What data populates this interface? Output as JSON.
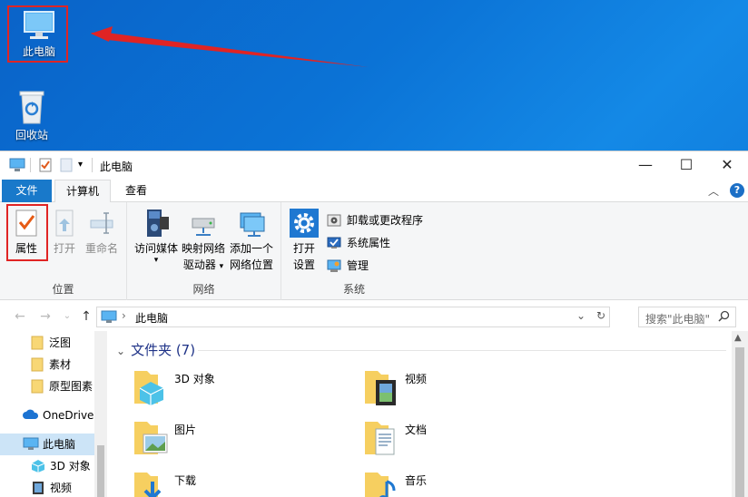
{
  "desktop": {
    "icons": [
      {
        "label": "此电脑"
      },
      {
        "label": "回收站"
      }
    ]
  },
  "window": {
    "title": "此电脑",
    "controls": {
      "minimize": "—",
      "maximize": "☐",
      "close": "✕"
    }
  },
  "tabs": {
    "file": "文件",
    "computer": "计算机",
    "view": "查看",
    "collapse_ribbon": "︿",
    "help": "?"
  },
  "ribbon": {
    "location": {
      "label": "位置",
      "properties": "属性",
      "open": "打开",
      "rename": "重命名"
    },
    "network": {
      "label": "网络",
      "access_media": "访问媒体",
      "map_drive_line1": "映射网络",
      "map_drive_line2": "驱动器",
      "add_location_line1": "添加一个",
      "add_location_line2": "网络位置"
    },
    "system": {
      "label": "系统",
      "open_settings_line1": "打开",
      "open_settings_line2": "设置",
      "uninstall": "卸载或更改程序",
      "system_properties": "系统属性",
      "manage": "管理"
    }
  },
  "address": {
    "path": "此电脑",
    "search_placeholder": "搜索\"此电脑\""
  },
  "navpane": {
    "items": [
      {
        "label": "泛图"
      },
      {
        "label": "素材"
      },
      {
        "label": "原型图素"
      },
      {
        "label": "OneDrive"
      },
      {
        "label": "此电脑"
      },
      {
        "label": "3D 对象"
      },
      {
        "label": "视频"
      }
    ]
  },
  "content": {
    "section_title": "文件夹 (7)",
    "folders": [
      {
        "name": "3D 对象"
      },
      {
        "name": "视频"
      },
      {
        "name": "图片"
      },
      {
        "name": "文档"
      },
      {
        "name": "下载"
      },
      {
        "name": "音乐"
      }
    ]
  },
  "colors": {
    "accent": "#1979ca",
    "annotation": "#e02424",
    "selected": "#cce4f7"
  }
}
